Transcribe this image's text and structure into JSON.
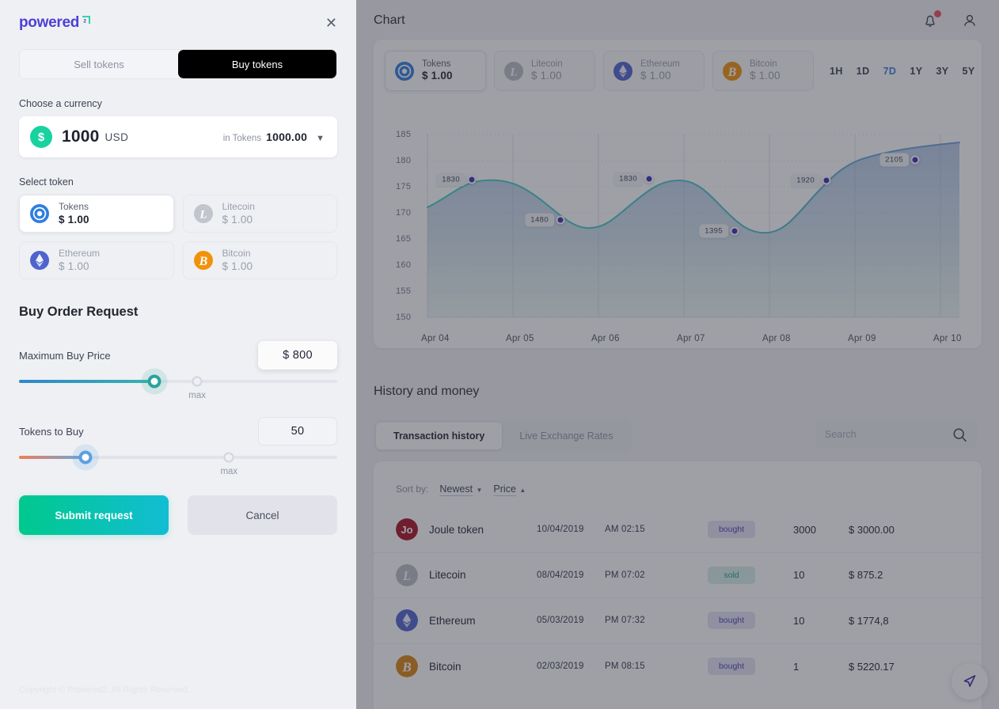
{
  "app": {
    "header": {
      "title": "Chart",
      "bell_icon": "bell-icon",
      "avatar_icon": "user-avatar-icon"
    },
    "chart_coins": [
      {
        "name": "Tokens",
        "price": "$ 1.00",
        "icon": "tokens-icon",
        "active": true
      },
      {
        "name": "Litecoin",
        "price": "$ 1.00",
        "icon": "litecoin-icon",
        "active": false
      },
      {
        "name": "Ethereum",
        "price": "$ 1.00",
        "icon": "ethereum-icon",
        "active": false
      },
      {
        "name": "Bitcoin",
        "price": "$ 1.00",
        "icon": "bitcoin-icon",
        "active": false
      }
    ],
    "ranges": [
      {
        "label": "1H",
        "active": false
      },
      {
        "label": "1D",
        "active": false
      },
      {
        "label": "7D",
        "active": true
      },
      {
        "label": "1Y",
        "active": false
      },
      {
        "label": "3Y",
        "active": false
      },
      {
        "label": "5Y",
        "active": false
      }
    ],
    "history": {
      "title": "History and money",
      "tabs": [
        {
          "label": "Transaction history",
          "active": true
        },
        {
          "label": "Live Exchange Rates",
          "active": false
        }
      ],
      "search_placeholder": "Search",
      "search_value": "",
      "search_icon": "search-icon",
      "sort_label": "Sort by:",
      "sort_options": [
        {
          "label": "Newest",
          "caret": "▼"
        },
        {
          "label": "Price",
          "caret": "▲"
        }
      ],
      "rows": [
        {
          "token": "Joule token",
          "icon": "joule-token-icon",
          "date": "10/04/2019",
          "time": "AM 02:15",
          "status": "bought",
          "amount": "3000",
          "total": "$ 3000.00"
        },
        {
          "token": "Litecoin",
          "icon": "litecoin-icon",
          "date": "08/04/2019",
          "time": "PM 07:02",
          "status": "sold",
          "amount": "10",
          "total": "$ 875.2"
        },
        {
          "token": "Ethereum",
          "icon": "ethereum-icon",
          "date": "05/03/2019",
          "time": "PM 07:32",
          "status": "bought",
          "amount": "10",
          "total": "$ 1774,8"
        },
        {
          "token": "Bitcoin",
          "icon": "bitcoin-icon",
          "date": "02/03/2019",
          "time": "PM 08:15",
          "status": "bought",
          "amount": "1",
          "total": "$ 5220.17"
        }
      ]
    },
    "fab_icon": "send-icon"
  },
  "chart_data": {
    "type": "area",
    "title": "Chart",
    "xlabel": "",
    "ylabel": "",
    "grid": true,
    "legend_position": "top-left",
    "ylim": [
      148,
      187
    ],
    "yticks": [
      150,
      155,
      160,
      165,
      170,
      175,
      180,
      185
    ],
    "xticks": [
      "Apr 04",
      "Apr 05",
      "Apr 06",
      "Apr 07",
      "Apr 08",
      "Apr 09",
      "Apr 10"
    ],
    "series": [
      {
        "name": "Tokens",
        "line_color": "#3fc4c4",
        "x": [
          "Apr 04",
          "Apr 04.5",
          "Apr 05",
          "Apr 05.5",
          "Apr 06",
          "Apr 06.5",
          "Apr 07",
          "Apr 07.5",
          "Apr 08",
          "Apr 08.5",
          "Apr 09",
          "Apr 09.5",
          "Apr 10"
        ],
        "values": [
          170.3,
          174.5,
          174.6,
          171.6,
          168.3,
          172.4,
          174.7,
          171.0,
          168.1,
          168.8,
          173.9,
          179.2,
          181.3,
          183.8
        ]
      }
    ],
    "annotations": [
      {
        "label": "1830",
        "x": "Apr 04.4",
        "y": 174.6
      },
      {
        "label": "1480",
        "x": "Apr 05.4",
        "y": 170.8
      },
      {
        "label": "1830",
        "x": "Apr 06.4",
        "y": 174.7
      },
      {
        "label": "1395",
        "x": "Apr 07.4",
        "y": 169.0
      },
      {
        "label": "1920",
        "x": "Apr 08.4",
        "y": 177.5
      },
      {
        "label": "2105",
        "x": "Apr 09.4",
        "y": 181.3
      }
    ]
  },
  "panel": {
    "logo_text": "powered",
    "logo_mark": "superscript-2-mark",
    "close_label": "✕",
    "tabs": [
      {
        "label": "Sell tokens",
        "active": false
      },
      {
        "label": "Buy tokens",
        "active": true
      }
    ],
    "currency": {
      "label": "Choose a currency",
      "icon": "dollar-icon",
      "amount": "1000",
      "code": "USD",
      "in_label": "in Tokens",
      "converted": "1000.00",
      "chevron": "chevron-down-icon"
    },
    "token_section_label": "Select token",
    "tokens": [
      {
        "name": "Tokens",
        "price": "$ 1.00",
        "icon": "tokens-icon",
        "active": true
      },
      {
        "name": "Litecoin",
        "price": "$ 1.00",
        "icon": "litecoin-icon",
        "active": false
      },
      {
        "name": "Ethereum",
        "price": "$ 1.00",
        "icon": "ethereum-icon",
        "active": false
      },
      {
        "name": "Bitcoin",
        "price": "$ 1.00",
        "icon": "bitcoin-icon",
        "active": false
      }
    ],
    "order": {
      "title": "Buy Order Request",
      "price_label": "Maximum Buy Price",
      "price_value": "$ 800",
      "price_max_label": "max",
      "tokens_label": "Tokens to Buy",
      "tokens_value": "50",
      "tokens_max_label": "max"
    },
    "submit_label": "Submit request",
    "cancel_label": "Cancel",
    "copyright": "Copyright © Powered2. All Rights Reserved."
  }
}
